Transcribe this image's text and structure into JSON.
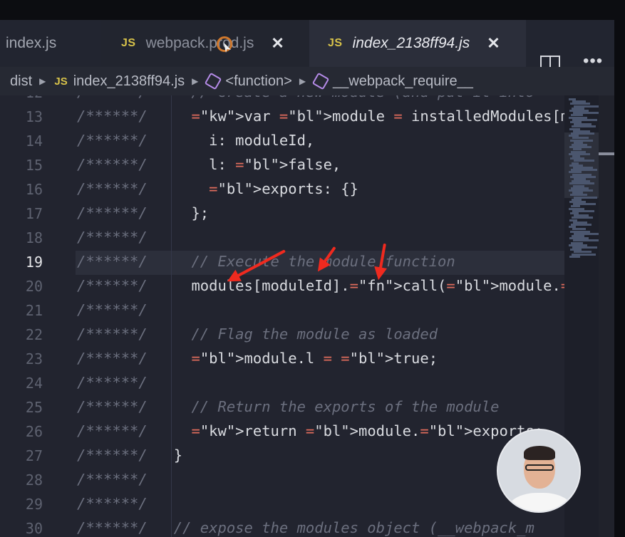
{
  "tabs": [
    {
      "label": "index.js",
      "badge": ""
    },
    {
      "label": "webpack.prod.js",
      "badge": "JS",
      "close": "✕"
    },
    {
      "label": "index_2138ff94.js",
      "badge": "JS",
      "close": "✕",
      "active": true
    }
  ],
  "breadcrumb": {
    "folder": "dist",
    "badge": "JS",
    "file": "index_2138ff94.js",
    "symbol1": "<function>",
    "symbol2": "__webpack_require__"
  },
  "icons": {
    "split_editor": "split-editor-icon",
    "more": "more-actions-icon",
    "chevron": "chevron-right-icon",
    "symbol": "symbol-method-icon"
  },
  "editor": {
    "active_line": 19,
    "colors": {
      "background": "#22242f",
      "comment": "#6b6f7e",
      "keyword": "#e06c5c",
      "builtin": "#6fb4e8",
      "function": "#b5d96a",
      "annotation_arrow": "#ef2a1f"
    },
    "lines": [
      {
        "n": "12",
        "text": "/******/     // Create a new module (and put it into"
      },
      {
        "n": "13",
        "text": "/******/     var module = installedModules[moduleId]"
      },
      {
        "n": "14",
        "text": "/******/       i: moduleId,"
      },
      {
        "n": "15",
        "text": "/******/       l: false,"
      },
      {
        "n": "16",
        "text": "/******/       exports: {}"
      },
      {
        "n": "17",
        "text": "/******/     };"
      },
      {
        "n": "18",
        "text": "/******/"
      },
      {
        "n": "19",
        "text": "/******/     // Execute the module function"
      },
      {
        "n": "20",
        "text": "/******/     modules[moduleId].call(module.exports,"
      },
      {
        "n": "21",
        "text": "/******/"
      },
      {
        "n": "22",
        "text": "/******/     // Flag the module as loaded"
      },
      {
        "n": "23",
        "text": "/******/     module.l = true;"
      },
      {
        "n": "24",
        "text": "/******/"
      },
      {
        "n": "25",
        "text": "/******/     // Return the exports of the module"
      },
      {
        "n": "26",
        "text": "/******/     return module.exports;"
      },
      {
        "n": "27",
        "text": "/******/   }"
      },
      {
        "n": "28",
        "text": "/******/"
      },
      {
        "n": "29",
        "text": "/******/"
      },
      {
        "n": "30",
        "text": "/******/   // expose the modules object (__webpack_m"
      }
    ]
  }
}
